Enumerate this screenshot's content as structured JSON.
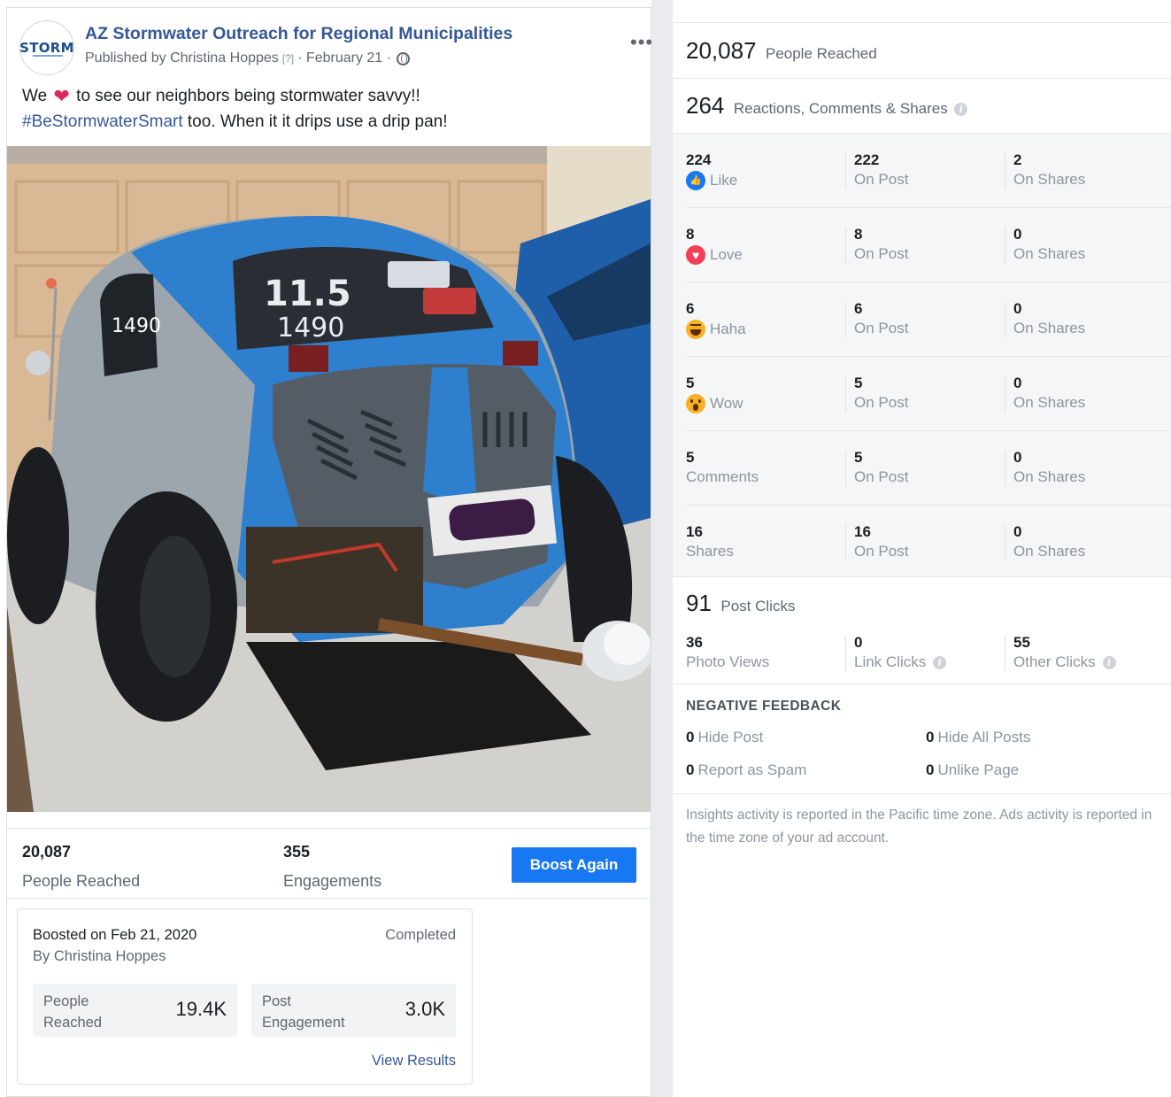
{
  "post": {
    "avatar_text": "STORM",
    "page_name": "AZ Stormwater Outreach for Regional Municipalities",
    "published_by": "Published by Christina Hoppes",
    "help_marker": "[?]",
    "date": "· February 21 ·",
    "text_part1": "We",
    "text_part2": "to see our neighbors being stormwater savvy!!",
    "hashtag": "#BeStormwaterSmart",
    "text_part3": "too. When it it drips use a drip pan!",
    "more_icon": "more-dots-icon"
  },
  "summary": {
    "people_reached_num": "20,087",
    "people_reached_label": "People Reached",
    "engagements_num": "355",
    "engagements_label": "Engagements",
    "boost_again_label": "Boost Again",
    "boost_button_color": "#1877f2"
  },
  "boost_card": {
    "title": "Boosted on Feb 21, 2020",
    "by": "By Christina Hoppes",
    "status": "Completed",
    "metric1_label_line1": "People",
    "metric1_label_line2": "Reached",
    "metric1_value": "19.4K",
    "metric2_label_line1": "Post",
    "metric2_label_line2": "Engagement",
    "metric2_value": "3.0K",
    "view_results": "View Results"
  },
  "insights": {
    "reached_num": "20,087",
    "reached_label": "People Reached",
    "rcs_num": "264",
    "rcs_label": "Reactions, Comments & Shares",
    "info_glyph": "i",
    "rows": [
      {
        "total": "224",
        "label": "Like",
        "icon": "like",
        "on_post": "222",
        "on_post_label": "On Post",
        "on_shares": "2",
        "on_shares_label": "On Shares"
      },
      {
        "total": "8",
        "label": "Love",
        "icon": "love",
        "on_post": "8",
        "on_post_label": "On Post",
        "on_shares": "0",
        "on_shares_label": "On Shares"
      },
      {
        "total": "6",
        "label": "Haha",
        "icon": "haha",
        "on_post": "6",
        "on_post_label": "On Post",
        "on_shares": "0",
        "on_shares_label": "On Shares"
      },
      {
        "total": "5",
        "label": "Wow",
        "icon": "wow",
        "on_post": "5",
        "on_post_label": "On Post",
        "on_shares": "0",
        "on_shares_label": "On Shares"
      },
      {
        "total": "5",
        "label": "Comments",
        "icon": "",
        "on_post": "5",
        "on_post_label": "On Post",
        "on_shares": "0",
        "on_shares_label": "On Shares"
      },
      {
        "total": "16",
        "label": "Shares",
        "icon": "",
        "on_post": "16",
        "on_post_label": "On Post",
        "on_shares": "0",
        "on_shares_label": "On Shares"
      }
    ],
    "post_clicks_num": "91",
    "post_clicks_label": "Post Clicks",
    "clicks": [
      {
        "num": "36",
        "label": "Photo Views",
        "info": false
      },
      {
        "num": "0",
        "label": "Link Clicks",
        "info": true
      },
      {
        "num": "55",
        "label": "Other Clicks",
        "info": true
      }
    ],
    "negative_title": "NEGATIVE FEEDBACK",
    "negative": [
      {
        "num": "0",
        "label": "Hide Post"
      },
      {
        "num": "0",
        "label": "Hide All Posts"
      },
      {
        "num": "0",
        "label": "Report as Spam"
      },
      {
        "num": "0",
        "label": "Unlike Page"
      }
    ],
    "footnote": "Insights activity is reported in the Pacific time zone. Ads activity is reported in the time zone of your ad account."
  },
  "photo": {
    "car_text1": "11.5",
    "car_text2": "1490",
    "car_side_text": "1490"
  }
}
